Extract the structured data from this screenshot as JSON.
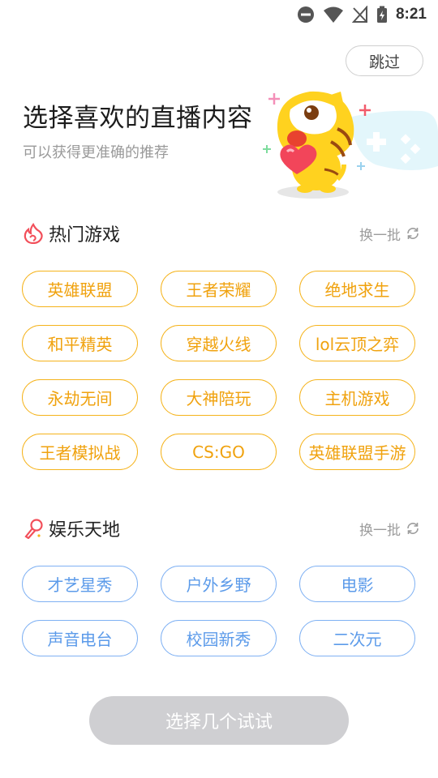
{
  "status_bar": {
    "time": "8:21"
  },
  "skip_label": "跳过",
  "title": "选择喜欢的直播内容",
  "subtitle": "可以获得更准确的推荐",
  "sections": [
    {
      "title": "热门游戏",
      "refresh_label": "换一批",
      "tags": [
        "英雄联盟",
        "王者荣耀",
        "绝地求生",
        "和平精英",
        "穿越火线",
        "lol云顶之弈",
        "永劫无间",
        "大神陪玩",
        "主机游戏",
        "王者模拟战",
        "CS:GO",
        "英雄联盟手游"
      ]
    },
    {
      "title": "娱乐天地",
      "refresh_label": "换一批",
      "tags": [
        "才艺星秀",
        "户外乡野",
        "电影",
        "声音电台",
        "校园新秀",
        "二次元"
      ]
    }
  ],
  "cta_label": "选择几个试试",
  "colors": {
    "game_accent": "#f5b31b",
    "ent_accent": "#7fb1f3",
    "cta_disabled": "#cfcfd2"
  },
  "icons": {
    "games_section": "flame-icon",
    "ent_section": "microphone-icon",
    "refresh": "refresh-icon"
  }
}
